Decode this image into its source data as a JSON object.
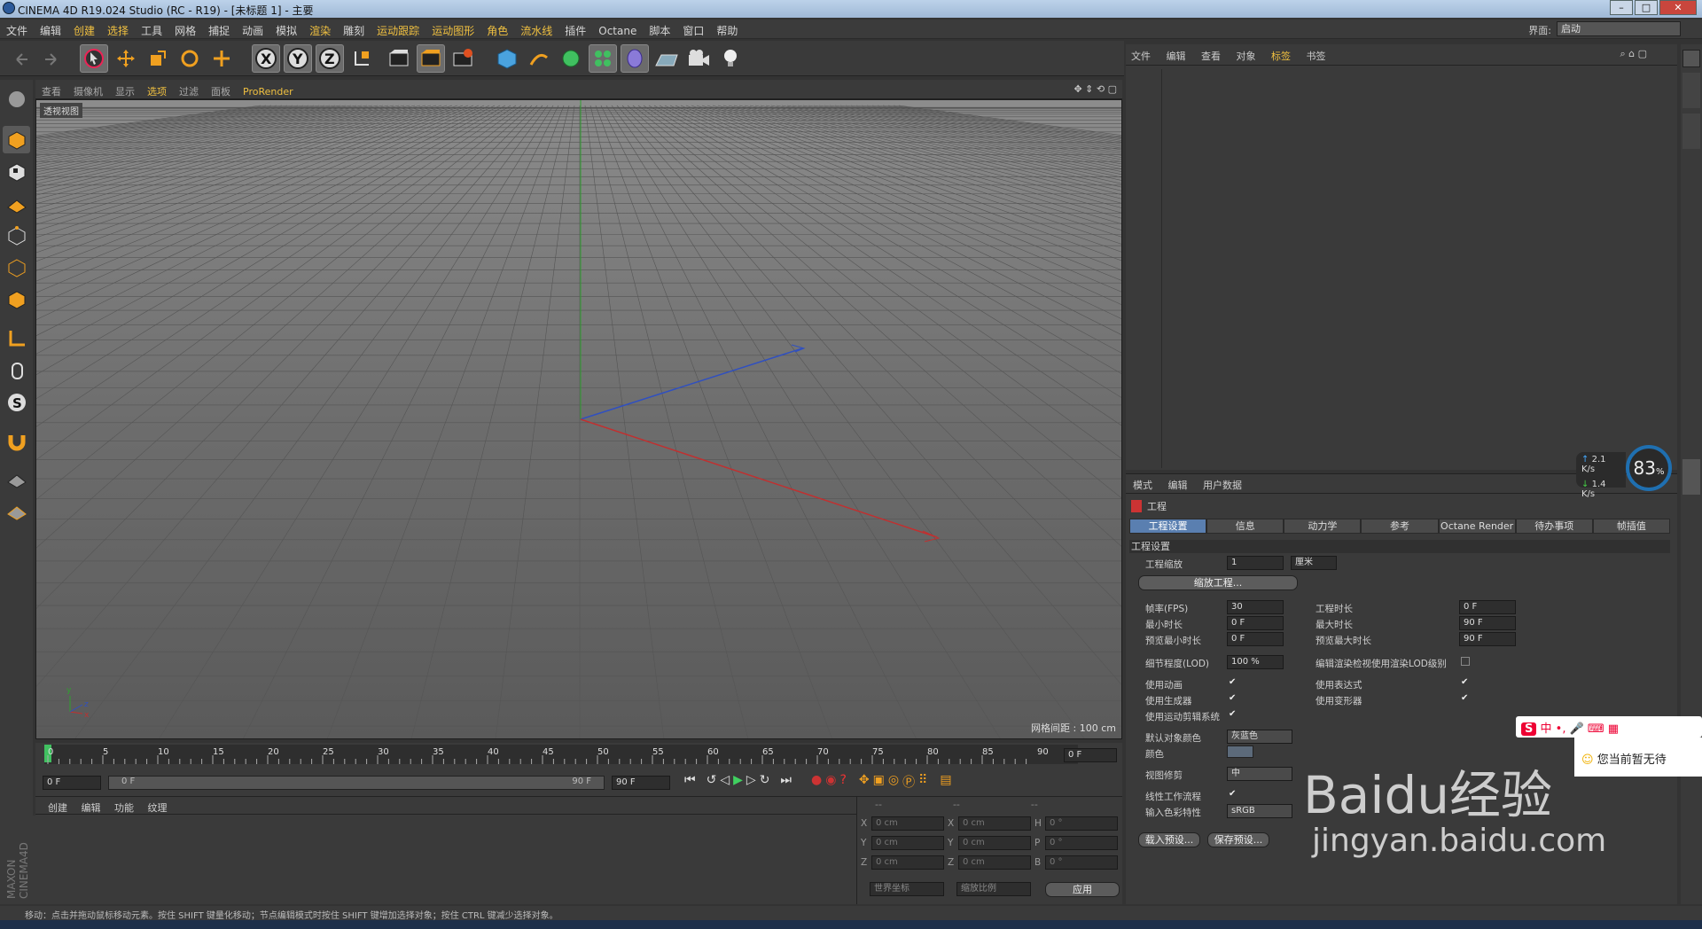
{
  "window": {
    "title": "CINEMA 4D R19.024 Studio (RC - R19) - [未标题 1] - 主要"
  },
  "menubar": {
    "items": [
      "文件",
      "编辑",
      "创建",
      "选择",
      "工具",
      "网格",
      "捕捉",
      "动画",
      "模拟",
      "渲染",
      "雕刻",
      "运动跟踪",
      "运动图形",
      "角色",
      "流水线",
      "插件",
      "Octane",
      "脚本",
      "窗口",
      "帮助"
    ],
    "interface_label": "界面:",
    "interface_value": "启动"
  },
  "viewport": {
    "menu": [
      "查看",
      "摄像机",
      "显示",
      "选项",
      "过滤",
      "面板",
      "ProRender"
    ],
    "label": "透视视图",
    "grid_distance": "网格间距 : 100 cm"
  },
  "timeline": {
    "ticks": [
      "0",
      "5",
      "10",
      "15",
      "20",
      "25",
      "30",
      "35",
      "40",
      "45",
      "50",
      "55",
      "60",
      "65",
      "70",
      "75",
      "80",
      "85",
      "90"
    ],
    "current": "0 F",
    "start": "0 F",
    "range_start": "0 F",
    "range_end": "90 F",
    "end": "90 F"
  },
  "material": {
    "menu": [
      "创建",
      "编辑",
      "功能",
      "纹理"
    ]
  },
  "coords": {
    "headers": [
      "--",
      "--",
      "--"
    ],
    "rows": [
      {
        "a": "X",
        "av": "0 cm",
        "b": "X",
        "bv": "0 cm",
        "c": "H",
        "cv": "0 °"
      },
      {
        "a": "Y",
        "av": "0 cm",
        "b": "Y",
        "bv": "0 cm",
        "c": "P",
        "cv": "0 °"
      },
      {
        "a": "Z",
        "av": "0 cm",
        "b": "Z",
        "bv": "0 cm",
        "c": "B",
        "cv": "0 °"
      }
    ],
    "world": "世界坐标",
    "scale": "缩放比例",
    "apply": "应用"
  },
  "objects": {
    "menu": [
      "文件",
      "编辑",
      "查看",
      "对象",
      "标签",
      "书签"
    ]
  },
  "attributes": {
    "menu": [
      "模式",
      "编辑",
      "用户数据"
    ],
    "title": "工程",
    "tabs": [
      "工程设置",
      "信息",
      "动力学",
      "参考",
      "Octane Render",
      "待办事项",
      "帧插值"
    ],
    "section": "工程设置",
    "project_scale_label": "工程缩放",
    "project_scale": "1",
    "unit": "厘米",
    "scale_button": "缩放工程...",
    "fps_label": "帧率(FPS)",
    "fps": "30",
    "duration_label": "工程时长",
    "duration": "0 F",
    "min_time_label": "最小时长",
    "min_time": "0 F",
    "max_time_label": "最大时长",
    "max_time": "90 F",
    "pmin_label": "预览最小时长",
    "pmin": "0 F",
    "pmax_label": "预览最大时长",
    "pmax": "90 F",
    "lod_label": "细节程度(LOD)",
    "lod": "100 %",
    "lod_render_label": "编辑渲染检视使用渲染LOD级别",
    "use_anim": "使用动画",
    "use_expr": "使用表达式",
    "use_gen": "使用生成器",
    "use_deform": "使用变形器",
    "use_motion": "使用运动剪辑系统",
    "default_color_label": "默认对象颜色",
    "default_color": "灰蓝色",
    "color_label": "颜色",
    "view_clip_label": "视图修剪",
    "view_clip": "中",
    "linear_label": "线性工作流程",
    "input_color_label": "输入色彩特性",
    "input_color": "sRGB",
    "load_preset": "载入预设...",
    "save_preset": "保存预设..."
  },
  "status": "移动：点击并拖动鼠标移动元素。按住 SHIFT 键量化移动；节点编辑模式时按住 SHIFT 键增加选择对象；按住 CTRL 键减少选择对象。",
  "overlay": {
    "up_speed": "2.1",
    "down_speed": "1.4",
    "speed_unit": "K/s",
    "cpu": "83",
    "cpu_unit": "%",
    "ime": "中",
    "notify": "您当前暂无待",
    "watermark": "Baidu经验",
    "watermark_url": "jingyan.baidu.com"
  },
  "colors": {
    "accent": "#f0c040",
    "tab_active": "#5a7fb0",
    "axis_x": "#c03030",
    "axis_y": "#30a030",
    "axis_z": "#3050c0"
  }
}
